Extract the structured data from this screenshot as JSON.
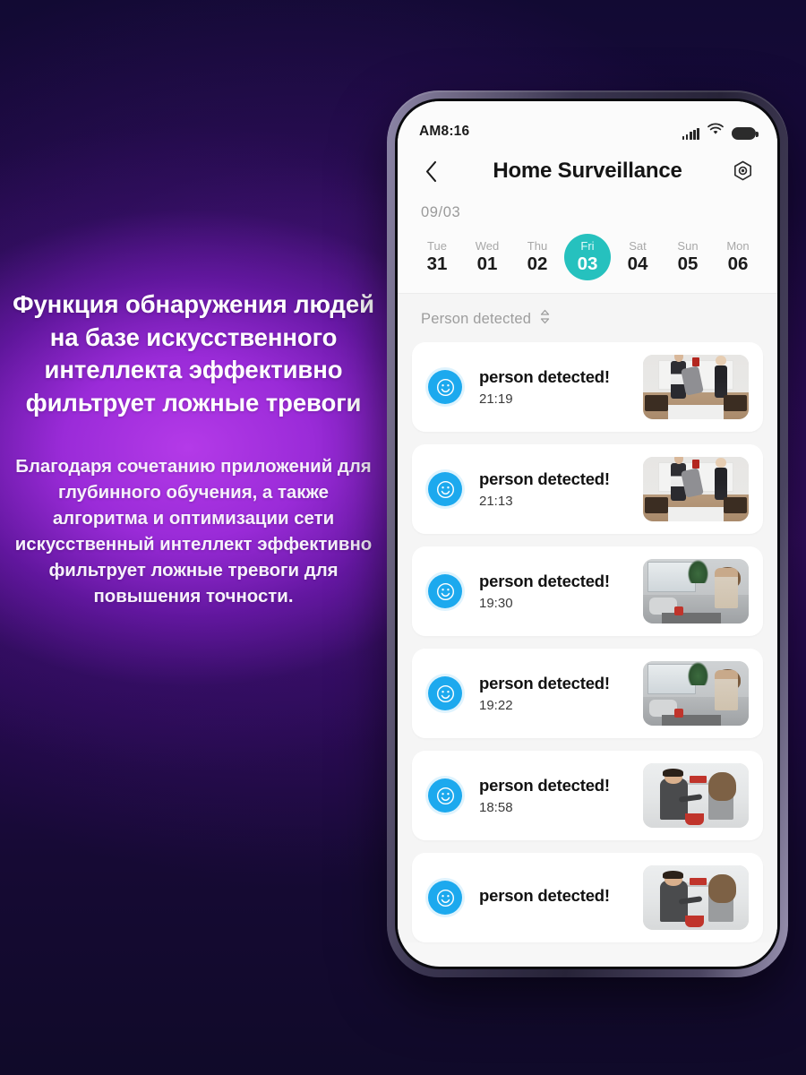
{
  "promo": {
    "headline": "Функция обнаружения людей на базе искусственного интеллекта эффективно фильтрует ложные тревоги",
    "body": "Благодаря сочетанию приложений для глубинного обучения, а также алгоритма и оптимизации сети искусственный интеллект эффективно фильтрует ложные тревоги для повышения точности."
  },
  "colors": {
    "accent_teal": "#26c1be",
    "avatar_blue": "#1ca9ee",
    "background_purple": "#9a2bd8",
    "background_navy": "#150a35",
    "card_white": "#ffffff",
    "screen_bg": "#f5f5f5"
  },
  "phone": {
    "status_bar": {
      "time": "AM8:16",
      "icons": [
        "signal-bars-icon",
        "wifi-icon",
        "battery-icon"
      ]
    },
    "nav": {
      "back_icon": "chevron-left-icon",
      "title": "Home  Surveillance",
      "settings_icon": "hex-bolt-settings-icon"
    },
    "date_strip": {
      "month_label": "09/03",
      "days": [
        {
          "dow": "Tue",
          "num": "31",
          "active": false
        },
        {
          "dow": "Wed",
          "num": "01",
          "active": false
        },
        {
          "dow": "Thu",
          "num": "02",
          "active": false
        },
        {
          "dow": "Fri",
          "num": "03",
          "active": true
        },
        {
          "dow": "Sat",
          "num": "04",
          "active": false
        },
        {
          "dow": "Sun",
          "num": "05",
          "active": false
        },
        {
          "dow": "Mon",
          "num": "06",
          "active": false
        }
      ]
    },
    "filter": {
      "label": "Person detected",
      "sort_icon": "sort-updown-icon"
    },
    "events": [
      {
        "title": "person detected!",
        "time": "21:19",
        "icon": "smiley-face-icon",
        "scene": "A"
      },
      {
        "title": "person detected!",
        "time": "21:13",
        "icon": "smiley-face-icon",
        "scene": "A"
      },
      {
        "title": "person detected!",
        "time": "19:30",
        "icon": "smiley-face-icon",
        "scene": "B"
      },
      {
        "title": "person detected!",
        "time": "19:22",
        "icon": "smiley-face-icon",
        "scene": "B"
      },
      {
        "title": "person detected!",
        "time": "18:58",
        "icon": "smiley-face-icon",
        "scene": "C"
      },
      {
        "title": "person detected!",
        "time": "",
        "icon": "smiley-face-icon",
        "scene": "C"
      }
    ]
  }
}
